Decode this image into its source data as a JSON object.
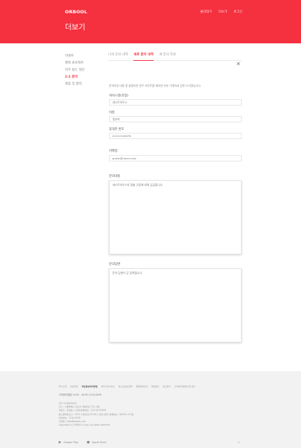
{
  "header": {
    "logo": "ORBOOL",
    "title": "더보기",
    "nav": [
      "불리대기",
      "더보기",
      "로그인"
    ]
  },
  "sidebar": {
    "items": [
      {
        "label": "이벤트",
        "active": false
      },
      {
        "label": "혜택 프로젝트",
        "active": false
      },
      {
        "label": "자주 묻는 질문",
        "active": false
      },
      {
        "label": "1:1 문의",
        "active": true
      },
      {
        "label": "제휴 및 협력",
        "active": false
      }
    ]
  },
  "tabs": [
    {
      "label": "나의 문의 내역",
      "active": false
    },
    {
      "label": "새로 문의 내역",
      "active": true
    },
    {
      "label": "새 문의 작성",
      "active": false
    }
  ],
  "form": {
    "notice": "문의하실 내용 중 불필요한 경우 포인트를 제외한 부분 기재하셔 답변 드리겠습니다.",
    "fields": [
      {
        "label": "서비스명(유형)",
        "value": "게스트하우스"
      },
      {
        "label": "이름",
        "value": "일본커"
      },
      {
        "label": "휴대폰 번호",
        "value": "01012345678"
      },
      {
        "label": "이메일",
        "value": "guest@naver.com"
      }
    ],
    "inquiry_label": "문의내용",
    "inquiry_text": "게스트하우스의 환불 규정에 대해 궁금합니다.",
    "answer_label": "문의답변",
    "answer_text": "문의 답변이 곧 등록됩니다."
  },
  "footer": {
    "links": [
      "회사소개",
      "이용약관",
      "개인정보처리방침",
      "위치기반서비스",
      "청소년보호정책",
      "회원탈퇴안내",
      "제휴문의",
      "광고문의",
      "고객센터/불편사항 접수"
    ],
    "strong_index": 2,
    "sub": "고객센터(평일 10:00 - 18:00)  1234-5678",
    "company": [
      "(주) 이너블에이아이",
      "주소 : 서울특별시 강남구 테헤란로 123, 4층",
      "대표자 : 홍길동 | 사업자등록번호 : 123-45-67890",
      "통신판매업신고 : 2021-서울강남-01234 | 관광사업자 등록번호 : 제2021-123호",
      "전화번호 : 1234-5678",
      "이메일 : help@orbool.com",
      "Copyright (c) ORBOOL Corp. All rights reserved."
    ],
    "stores": [
      {
        "icon": "▶",
        "label": "Google Play"
      },
      {
        "icon": "●",
        "label": "Apple Store"
      }
    ],
    "top": "^"
  }
}
